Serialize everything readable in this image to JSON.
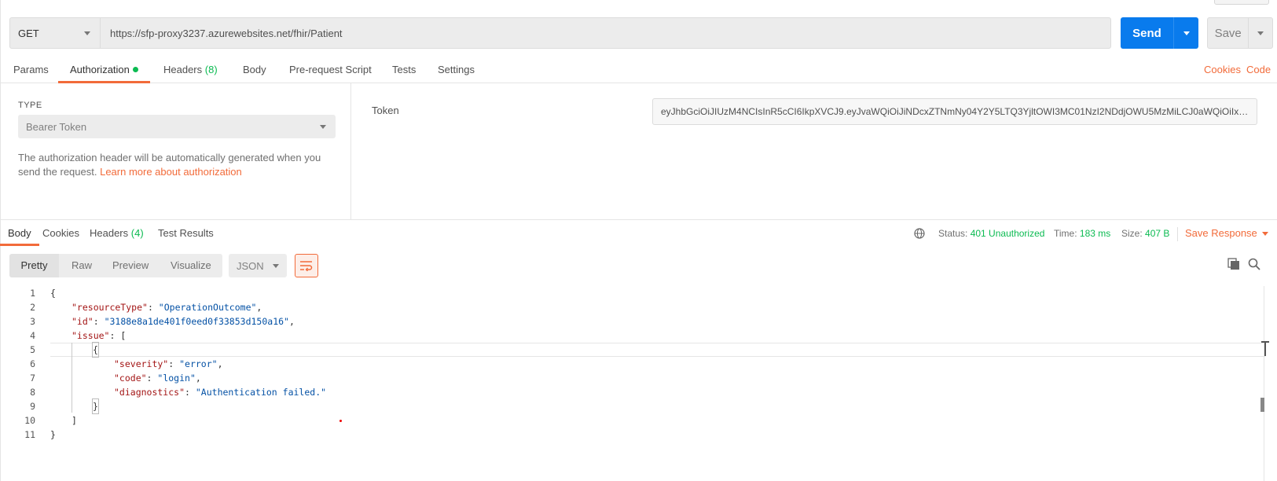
{
  "request": {
    "method": "GET",
    "url": "https://sfp-proxy3237.azurewebsites.net/fhir/Patient",
    "send_label": "Send",
    "save_label": "Save"
  },
  "request_tabs": {
    "params": "Params",
    "authorization": "Authorization",
    "headers": "Headers",
    "headers_count": "(8)",
    "body": "Body",
    "prerequest": "Pre-request Script",
    "tests": "Tests",
    "settings": "Settings",
    "cookies_link": "Cookies",
    "code_link": "Code"
  },
  "auth": {
    "type_label": "TYPE",
    "type_value": "Bearer Token",
    "description": "The authorization header will be automatically generated when you send the request.",
    "learn_more": "Learn more about authorization",
    "token_label": "Token",
    "token_value": "eyJhbGciOiJIUzM4NCIsInR5cCI6IkpXVCJ9.eyJvaWQiOiJiNDcxZTNmNy04Y2Y5LTQ3YjltOWI3MC01NzI2NDdjOWU5MzMiLCJ0aWQiOiIxNG..."
  },
  "response_tabs": {
    "body": "Body",
    "cookies": "Cookies",
    "headers": "Headers",
    "headers_count": "(4)",
    "test_results": "Test Results"
  },
  "response_status": {
    "status_label": "Status:",
    "status_value": "401 Unauthorized",
    "time_label": "Time:",
    "time_value": "183 ms",
    "size_label": "Size:",
    "size_value": "407 B",
    "save_response": "Save Response"
  },
  "view": {
    "pretty": "Pretty",
    "raw": "Raw",
    "preview": "Preview",
    "visualize": "Visualize",
    "format": "JSON"
  },
  "code_lines": [
    {
      "num": "1",
      "text": "{"
    },
    {
      "num": "2",
      "key": "\"resourceType\"",
      "val": "\"OperationOutcome\"",
      "tail": ","
    },
    {
      "num": "3",
      "key": "\"id\"",
      "val": "\"3188e8a1de401f0eed0f33853d150a16\"",
      "tail": ","
    },
    {
      "num": "4",
      "key": "\"issue\"",
      "tail": ": ["
    },
    {
      "num": "5",
      "text": "{"
    },
    {
      "num": "6",
      "key": "\"severity\"",
      "val": "\"error\"",
      "tail": ","
    },
    {
      "num": "7",
      "key": "\"code\"",
      "val": "\"login\"",
      "tail": ","
    },
    {
      "num": "8",
      "key": "\"diagnostics\"",
      "val": "\"Authentication failed.\"",
      "tail": ""
    },
    {
      "num": "9",
      "text": "}"
    },
    {
      "num": "10",
      "text": "]"
    },
    {
      "num": "11",
      "text": "}"
    }
  ],
  "colors": {
    "accent": "#f26b3a",
    "send_blue": "#097bed",
    "success_green": "#0cbb52",
    "json_key": "#a31515",
    "json_string": "#0451a5"
  },
  "icons": {
    "method_dropdown": "chevron-down-icon",
    "globe": "globe-icon",
    "wrap": "wrap-lines-icon",
    "copy": "copy-icon",
    "search": "search-icon"
  }
}
